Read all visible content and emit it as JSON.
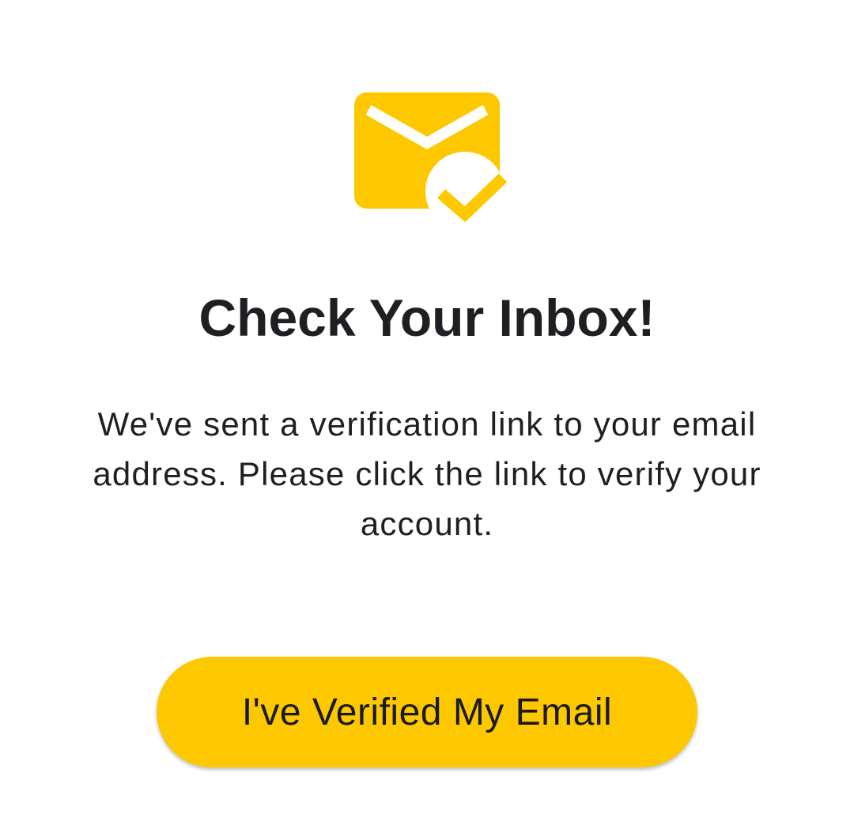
{
  "colors": {
    "accent": "#FDC800",
    "text": "#1E1F22",
    "background": "#FFFFFF"
  },
  "icon": {
    "name": "mail-check-icon"
  },
  "heading": {
    "title": "Check Your Inbox!"
  },
  "message": {
    "body": "We've sent a verification link to your email address. Please click the link to verify your account."
  },
  "actions": {
    "verified_label": "I've Verified My Email"
  }
}
